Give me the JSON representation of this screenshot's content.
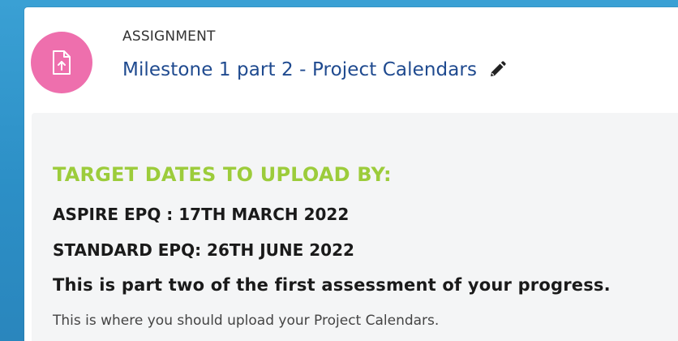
{
  "activity": {
    "type_label": "ASSIGNMENT",
    "title": "Milestone 1 part 2 - Project Calendars",
    "icon": "file-upload-icon",
    "icon_color": "#ee6fad",
    "edit_icon": "pencil-icon"
  },
  "description": {
    "heading": "TARGET DATES TO UPLOAD BY:",
    "heading_color": "#9ccc3b",
    "aspire_date": "ASPIRE EPQ : 17TH MARCH 2022",
    "standard_date": "STANDARD EPQ: 26TH JUNE 2022",
    "part_two": "This is part two of the first assessment of your progress.",
    "instruction": "This is where you should upload your Project Calendars."
  }
}
